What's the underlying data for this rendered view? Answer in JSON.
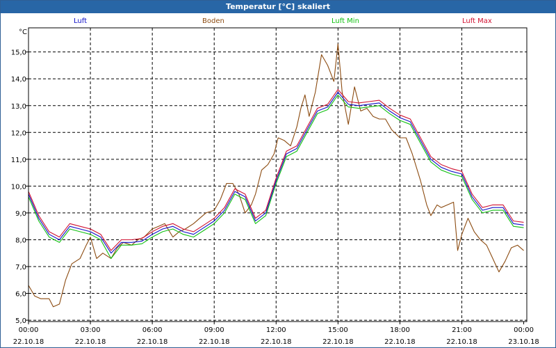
{
  "window": {
    "title": "Temperatur [°C] skaliert"
  },
  "chart_data": {
    "type": "line",
    "title": "Temperatur [°C] skaliert",
    "ylabel": "°C",
    "ylim": [
      4.95,
      15.9
    ],
    "grid": true,
    "legend_position": "top",
    "yticks": [
      "5,0",
      "6,0",
      "7,0",
      "8,0",
      "9,0",
      "10,0",
      "11,0",
      "12,0",
      "13,0",
      "14,0",
      "15,0"
    ],
    "ytick_values": [
      5,
      6,
      7,
      8,
      9,
      10,
      11,
      12,
      13,
      14,
      15
    ],
    "xlim": [
      0,
      24.15
    ],
    "xticks": [
      {
        "time": "00:00",
        "date": "22.10.18",
        "hour": 0
      },
      {
        "time": "03:00",
        "date": "22.10.18",
        "hour": 3
      },
      {
        "time": "06:00",
        "date": "22.10.18",
        "hour": 6
      },
      {
        "time": "09:00",
        "date": "22.10.18",
        "hour": 9
      },
      {
        "time": "12:00",
        "date": "22.10.18",
        "hour": 12
      },
      {
        "time": "15:00",
        "date": "22.10.18",
        "hour": 15
      },
      {
        "time": "18:00",
        "date": "22.10.18",
        "hour": 18
      },
      {
        "time": "21:00",
        "date": "22.10.18",
        "hour": 21
      },
      {
        "time": "00:00",
        "date": "23.10.18",
        "hour": 24
      }
    ],
    "series": [
      {
        "name": "Luft",
        "color": "#1010c8",
        "x": [
          0,
          0.5,
          1,
          1.5,
          2,
          2.5,
          3,
          3.5,
          4,
          4.5,
          5,
          5.5,
          6,
          6.5,
          7,
          7.5,
          8,
          8.5,
          9,
          9.5,
          10,
          10.5,
          11,
          11.5,
          12,
          12.5,
          13,
          13.5,
          14,
          14.5,
          15,
          15.5,
          16,
          16.5,
          17,
          17.5,
          18,
          18.5,
          19,
          19.5,
          20,
          20.5,
          21,
          21.5,
          22,
          22.5,
          23,
          23.5,
          24
        ],
        "values": [
          9.7,
          8.8,
          8.2,
          8.0,
          8.5,
          8.4,
          8.3,
          8.1,
          7.5,
          7.9,
          7.9,
          7.95,
          8.2,
          8.4,
          8.5,
          8.3,
          8.2,
          8.45,
          8.7,
          9.1,
          9.8,
          9.6,
          8.7,
          9.0,
          10.2,
          11.2,
          11.4,
          12.1,
          12.8,
          12.95,
          13.5,
          13.05,
          13.0,
          13.05,
          13.1,
          12.8,
          12.55,
          12.4,
          11.7,
          11.0,
          10.7,
          10.55,
          10.45,
          9.6,
          9.1,
          9.2,
          9.2,
          8.6,
          8.55
        ]
      },
      {
        "name": "Boden",
        "color": "#8b4a0f",
        "x": [
          0,
          0.3,
          0.6,
          1,
          1.2,
          1.5,
          1.8,
          2.1,
          2.5,
          2.8,
          3,
          3.3,
          3.6,
          4,
          4.3,
          4.6,
          5,
          5.3,
          5.6,
          6,
          6.3,
          6.6,
          7,
          7.3,
          7.6,
          8,
          8.3,
          8.6,
          9,
          9.3,
          9.6,
          9.9,
          10.2,
          10.5,
          10.8,
          11,
          11.3,
          11.6,
          11.9,
          12.1,
          12.4,
          12.7,
          13,
          13.2,
          13.4,
          13.6,
          13.9,
          14.2,
          14.5,
          14.8,
          15,
          15.2,
          15.5,
          15.8,
          16.1,
          16.4,
          16.7,
          17,
          17.3,
          17.6,
          18,
          18.3,
          18.6,
          19,
          19.3,
          19.5,
          19.8,
          20,
          20.3,
          20.6,
          20.8,
          21,
          21.3,
          21.6,
          21.9,
          22.2,
          22.5,
          22.8,
          23.1,
          23.4,
          23.7,
          24
        ],
        "values": [
          6.3,
          5.9,
          5.8,
          5.8,
          5.5,
          5.6,
          6.5,
          7.1,
          7.3,
          7.8,
          8.1,
          7.3,
          7.5,
          7.3,
          7.7,
          7.9,
          7.8,
          8.0,
          8.1,
          8.4,
          8.5,
          8.6,
          8.1,
          8.3,
          8.4,
          8.6,
          8.8,
          9.0,
          9.1,
          9.5,
          10.1,
          10.1,
          9.7,
          9.0,
          9.3,
          9.7,
          10.6,
          10.8,
          11.2,
          11.8,
          11.7,
          11.5,
          12.2,
          12.9,
          13.4,
          12.6,
          13.5,
          14.9,
          14.5,
          13.9,
          15.3,
          13.5,
          12.3,
          13.7,
          12.8,
          12.9,
          12.6,
          12.5,
          12.5,
          12.1,
          11.8,
          11.8,
          11.2,
          10.2,
          9.3,
          8.9,
          9.3,
          9.2,
          9.3,
          9.4,
          7.6,
          8.2,
          8.8,
          8.3,
          8.0,
          7.8,
          7.3,
          6.8,
          7.2,
          7.7,
          7.8,
          7.6
        ]
      },
      {
        "name": "Luft Min",
        "color": "#10c010",
        "x": [
          0,
          0.5,
          1,
          1.5,
          2,
          2.5,
          3,
          3.5,
          4,
          4.5,
          5,
          5.5,
          6,
          6.5,
          7,
          7.5,
          8,
          8.5,
          9,
          9.5,
          10,
          10.5,
          11,
          11.5,
          12,
          12.5,
          13,
          13.5,
          14,
          14.5,
          15,
          15.5,
          16,
          16.5,
          17,
          17.5,
          18,
          18.5,
          19,
          19.5,
          20,
          20.5,
          21,
          21.5,
          22,
          22.5,
          23,
          23.5,
          24
        ],
        "values": [
          9.6,
          8.7,
          8.1,
          7.9,
          8.4,
          8.3,
          8.2,
          8.0,
          7.3,
          7.8,
          7.8,
          7.85,
          8.1,
          8.3,
          8.4,
          8.2,
          8.1,
          8.35,
          8.6,
          9.0,
          9.7,
          9.5,
          8.6,
          8.9,
          10.1,
          11.1,
          11.3,
          12.0,
          12.7,
          12.85,
          13.4,
          12.95,
          12.9,
          12.95,
          13.0,
          12.7,
          12.45,
          12.3,
          11.6,
          10.9,
          10.6,
          10.45,
          10.35,
          9.5,
          9.0,
          9.1,
          9.1,
          8.5,
          8.45
        ]
      },
      {
        "name": "Luft Max",
        "color": "#d01030",
        "x": [
          0,
          0.5,
          1,
          1.5,
          2,
          2.5,
          3,
          3.5,
          4,
          4.5,
          5,
          5.5,
          6,
          6.5,
          7,
          7.5,
          8,
          8.5,
          9,
          9.5,
          10,
          10.5,
          11,
          11.5,
          12,
          12.5,
          13,
          13.5,
          14,
          14.5,
          15,
          15.5,
          16,
          16.5,
          17,
          17.5,
          18,
          18.5,
          19,
          19.5,
          20,
          20.5,
          21,
          21.5,
          22,
          22.5,
          23,
          23.5,
          24
        ],
        "values": [
          9.8,
          8.9,
          8.3,
          8.1,
          8.6,
          8.5,
          8.4,
          8.2,
          7.6,
          8.0,
          8.0,
          8.05,
          8.3,
          8.5,
          8.6,
          8.4,
          8.3,
          8.55,
          8.8,
          9.2,
          9.9,
          9.7,
          8.8,
          9.1,
          10.3,
          11.3,
          11.5,
          12.2,
          12.9,
          13.05,
          13.6,
          13.15,
          13.1,
          13.15,
          13.2,
          12.9,
          12.65,
          12.5,
          11.8,
          11.1,
          10.8,
          10.65,
          10.55,
          9.7,
          9.2,
          9.3,
          9.3,
          8.7,
          8.65
        ]
      }
    ]
  }
}
